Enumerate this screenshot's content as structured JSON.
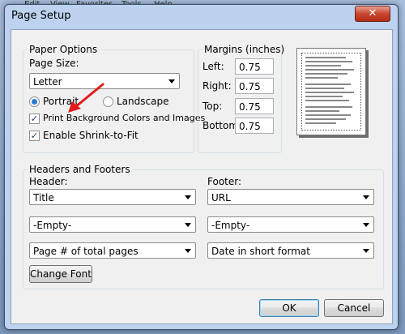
{
  "background": {
    "menu": [
      "Edit",
      "View",
      "Favorites",
      "Tools",
      "Help"
    ]
  },
  "dialog": {
    "title": "Page Setup",
    "close_glyph": "✕"
  },
  "paper_options": {
    "legend": "Paper Options",
    "page_size_label": "Page Size:",
    "page_size_value": "Letter",
    "portrait_label": "Portrait",
    "landscape_label": "Landscape",
    "orientation_selected": "Portrait",
    "print_bg_label": "Print Background Colors and Images",
    "print_bg_checked": true,
    "shrink_label": "Enable Shrink-to-Fit",
    "shrink_checked": true
  },
  "margins": {
    "legend": "Margins (inches)",
    "left_label": "Left:",
    "left_value": "0.75",
    "right_label": "Right:",
    "right_value": "0.75",
    "top_label": "Top:",
    "top_value": "0.75",
    "bottom_label": "Bottom:",
    "bottom_value": "0.75"
  },
  "headers_footers": {
    "legend": "Headers and Footers",
    "header_label": "Header:",
    "footer_label": "Footer:",
    "header_rows": [
      "Title",
      "-Empty-",
      "Page # of total pages"
    ],
    "footer_rows": [
      "URL",
      "-Empty-",
      "Date in short format"
    ],
    "change_font_label": "Change Font"
  },
  "buttons": {
    "ok_label": "OK",
    "cancel_label": "Cancel"
  },
  "colors": {
    "accent_radio": "#2a7ad5",
    "annotation_arrow": "#e21b1b",
    "close_button": "#c8452f"
  }
}
